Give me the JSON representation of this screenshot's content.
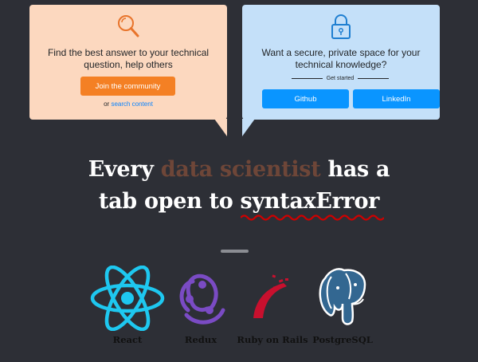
{
  "cards": {
    "left": {
      "icon": "search-icon",
      "text": "Find the best answer to your technical question, help others",
      "button_label": "Join the community",
      "or_text": "or",
      "link_text": "search content"
    },
    "right": {
      "icon": "lock-icon",
      "text": "Want a secure, private space for your technical knowledge?",
      "get_started": "Get started",
      "github_label": "Github",
      "linkedin_label": "LinkedIn"
    }
  },
  "headline": {
    "word1": "Every",
    "faded": "data scientist",
    "word2": "has a",
    "line2a": "tab open to",
    "brand": "syntaxError"
  },
  "tech": [
    {
      "name": "React",
      "icon": "react-logo"
    },
    {
      "name": "Redux",
      "icon": "redux-logo"
    },
    {
      "name": "Ruby on Rails",
      "icon": "rails-logo"
    },
    {
      "name": "PostgreSQL",
      "icon": "postgresql-logo"
    }
  ],
  "colors": {
    "background": "#2d2f36",
    "card_left": "#fcd8bf",
    "card_right": "#c4e0f9",
    "accent_orange": "#f48024",
    "accent_blue": "#0a95ff",
    "squiggle_red": "#d00000"
  }
}
